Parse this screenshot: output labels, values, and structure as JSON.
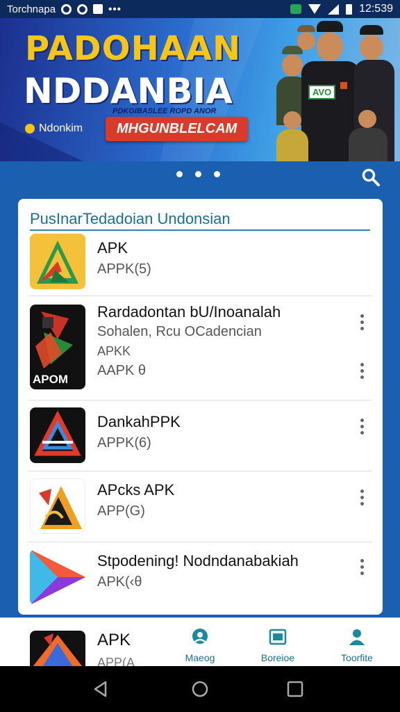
{
  "status_bar": {
    "carrier": "Torchnapa",
    "time": "12:539"
  },
  "banner": {
    "title_line1": "PADOHAAN",
    "title_line2": "NDDANBIA",
    "subtitle": "PDKGIBASLEE ROPD ANOR",
    "logo_text": "Ndonkim",
    "cta_label": "MHGUNBLELCAM",
    "badge": "AVO"
  },
  "card": {
    "title": "PusInarTedadoian Undonsian",
    "items": [
      {
        "title": "APK",
        "sub1": "APPK(5)"
      },
      {
        "title": "Rardadontan bU/Inoanalah",
        "sub1": "Sohalen, Rcu OCadencian",
        "sub2": "APKK",
        "sub3": "AAPK θ",
        "icon_label": "APOM"
      },
      {
        "title": "DankahPPK",
        "sub1": "APPK(6)"
      },
      {
        "title": "APcks APK",
        "sub1": "APP(G)"
      },
      {
        "title": "Stpodening! Nodndanabakiah",
        "sub1": "APK(‹θ"
      }
    ]
  },
  "bottom_nav": {
    "app_title": "APK",
    "app_sub": "APP(A",
    "tabs": [
      {
        "label": "Maeog",
        "icon": "chat-icon"
      },
      {
        "label": "Boreioe",
        "icon": "browser-icon"
      },
      {
        "label": "Toorfite",
        "icon": "profile-icon"
      }
    ]
  },
  "colors": {
    "accent": "#1b6f8c",
    "banner_yellow": "#f5c518",
    "cta_red": "#d93a2a",
    "background_blue": "#1a5fb0"
  }
}
